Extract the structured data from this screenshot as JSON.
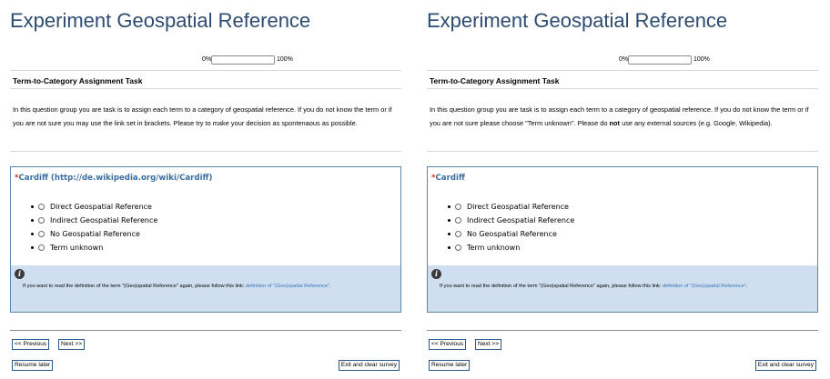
{
  "panels": [
    {
      "title": "Experiment Geospatial Reference",
      "progress": {
        "min_label": "0%",
        "max_label": "100%",
        "value_percent": 0
      },
      "group": {
        "title": "Term-to-Category Assignment Task",
        "description": "In this question group you are task is to assign each term to a category of geospatial reference. If you do not know the term or if you are not sure you may use the link set in brackets. Please try to make your decision as spontenaous as possible."
      },
      "question": {
        "mandatory_mark": "*",
        "text": "Cardiff (http://de.wikipedia.org/wiki/Cardiff)",
        "answers": [
          "Direct Geospatial Reference",
          "Indirect Geospatial Reference",
          "No Geospatial Reference",
          "Term unknown"
        ],
        "help": {
          "text_before": "If you want to read the definition of the term \"(Geo)spatial Reference\" again, please follow this link: ",
          "link": "definition of \"(Geo)spatial Reference\"",
          "text_after": "."
        }
      },
      "nav": {
        "previous": "<< Previous",
        "next": "Next >>",
        "resume": "Resume later",
        "exit": "Exit and clear survey"
      }
    },
    {
      "title": "Experiment Geospatial Reference",
      "progress": {
        "min_label": "0%",
        "max_label": "100%",
        "value_percent": 0
      },
      "group": {
        "title": "Term-to-Category Assignment Task",
        "description_parts": [
          "In this question group you are task is to assign each term to a category of geospatial reference. If you do not know the term or if you are not sure please choose \"Term unknown\". Please do ",
          "not",
          " use any external sources (e.g. Google, Wikipedia)."
        ]
      },
      "question": {
        "mandatory_mark": "*",
        "text": "Cardiff",
        "answers": [
          "Direct Geospatial Reference",
          "Indirect Geospatial Reference",
          "No Geospatial Reference",
          "Term unknown"
        ],
        "help": {
          "text_before": "If you want to read the definition of the term \"(Geo)spatial Reference\" again, please follow this link: ",
          "link": "definition of \"(Geo)spatial Reference\"",
          "text_after": "."
        }
      },
      "nav": {
        "previous": "<< Previous",
        "next": "Next >>",
        "resume": "Resume later",
        "exit": "Exit and clear survey"
      }
    }
  ]
}
